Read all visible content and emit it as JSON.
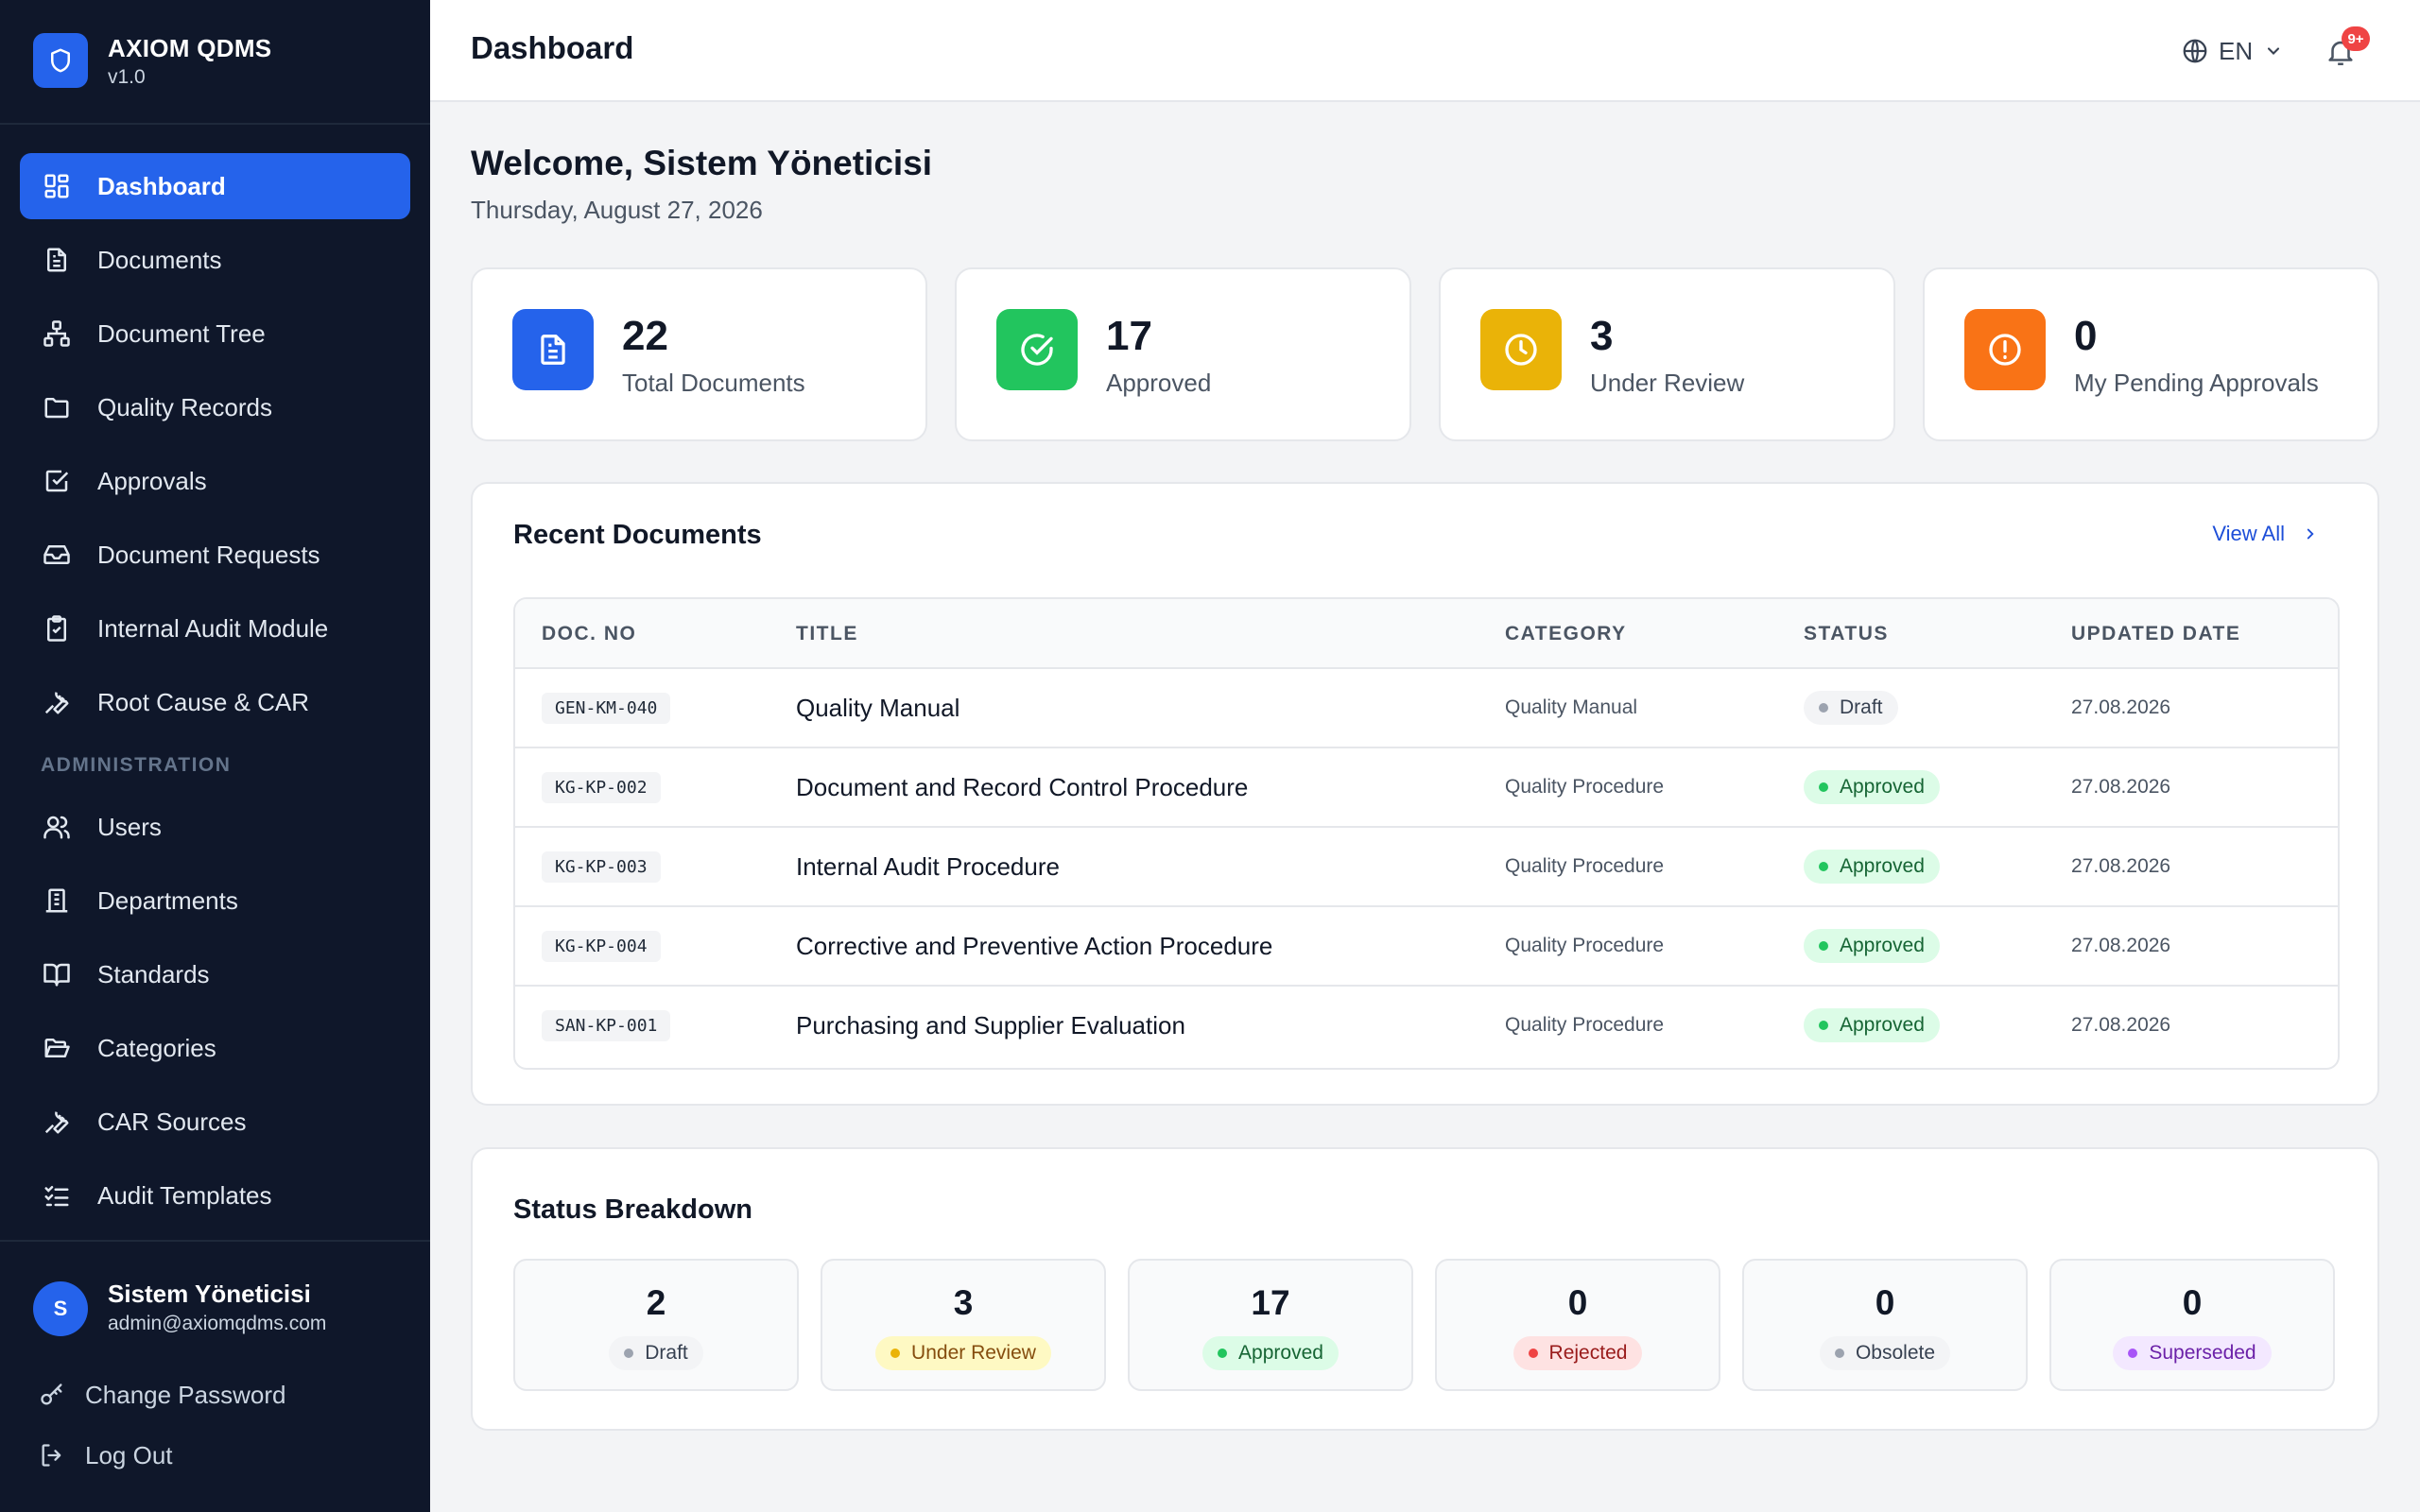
{
  "brand": {
    "name": "AXIOM QDMS",
    "version": "v1.0",
    "logo_icon": "shield-icon",
    "accent": "#2563eb"
  },
  "sidebar": {
    "items": [
      {
        "label": "Dashboard",
        "icon": "grid-icon",
        "active": true
      },
      {
        "label": "Documents",
        "icon": "document-icon"
      },
      {
        "label": "Document Tree",
        "icon": "tree-icon"
      },
      {
        "label": "Quality Records",
        "icon": "folder-icon"
      },
      {
        "label": "Approvals",
        "icon": "check-square-icon"
      },
      {
        "label": "Document Requests",
        "icon": "inbox-icon"
      },
      {
        "label": "Internal Audit Module",
        "icon": "clipboard-check-icon"
      },
      {
        "label": "Root Cause & CAR",
        "icon": "wrench-icon"
      }
    ],
    "admin_section": "ADMINISTRATION",
    "admin_items": [
      {
        "label": "Users",
        "icon": "users-icon"
      },
      {
        "label": "Departments",
        "icon": "building-icon"
      },
      {
        "label": "Standards",
        "icon": "book-icon"
      },
      {
        "label": "Categories",
        "icon": "folder-open-icon"
      },
      {
        "label": "CAR Sources",
        "icon": "wrench-icon"
      },
      {
        "label": "Audit Templates",
        "icon": "list-check-icon"
      }
    ],
    "user": {
      "initial": "S",
      "name": "Sistem Yöneticisi",
      "email": "admin@axiomqdms.com"
    },
    "change_password": "Change Password",
    "logout": "Log Out"
  },
  "header": {
    "title": "Dashboard",
    "language": "EN",
    "notifications_badge": "9+"
  },
  "welcome": {
    "heading": "Welcome, Sistem Yöneticisi",
    "date": "Thursday, August 27, 2026"
  },
  "stats": [
    {
      "value": "22",
      "label": "Total Documents",
      "color": "#2563eb",
      "icon": "document-icon"
    },
    {
      "value": "17",
      "label": "Approved",
      "color": "#22c55e",
      "icon": "check-circle-icon"
    },
    {
      "value": "3",
      "label": "Under Review",
      "color": "#eab308",
      "icon": "clock-icon"
    },
    {
      "value": "0",
      "label": "My Pending Approvals",
      "color": "#f97316",
      "icon": "alert-circle-icon"
    }
  ],
  "recent": {
    "title": "Recent Documents",
    "view_all": "View All",
    "columns": [
      "DOC. NO",
      "TITLE",
      "CATEGORY",
      "STATUS",
      "UPDATED DATE"
    ],
    "rows": [
      {
        "doc_no": "GEN-KM-040",
        "title": "Quality Manual",
        "category": "Quality Manual",
        "status": "Draft",
        "date": "27.08.2026"
      },
      {
        "doc_no": "KG-KP-002",
        "title": "Document and Record Control Procedure",
        "category": "Quality Procedure",
        "status": "Approved",
        "date": "27.08.2026"
      },
      {
        "doc_no": "KG-KP-003",
        "title": "Internal Audit Procedure",
        "category": "Quality Procedure",
        "status": "Approved",
        "date": "27.08.2026"
      },
      {
        "doc_no": "KG-KP-004",
        "title": "Corrective and Preventive Action Procedure",
        "category": "Quality Procedure",
        "status": "Approved",
        "date": "27.08.2026"
      },
      {
        "doc_no": "SAN-KP-001",
        "title": "Purchasing and Supplier Evaluation",
        "category": "Quality Procedure",
        "status": "Approved",
        "date": "27.08.2026"
      }
    ]
  },
  "breakdown": {
    "title": "Status Breakdown",
    "items": [
      {
        "value": "2",
        "label": "Draft",
        "bg": "#f3f4f6",
        "fg": "#374151",
        "dot": "#9ca3af"
      },
      {
        "value": "3",
        "label": "Under Review",
        "bg": "#fef9c3",
        "fg": "#854d0e",
        "dot": "#eab308"
      },
      {
        "value": "17",
        "label": "Approved",
        "bg": "#dcfce7",
        "fg": "#166534",
        "dot": "#22c55e"
      },
      {
        "value": "0",
        "label": "Rejected",
        "bg": "#fee2e2",
        "fg": "#991b1b",
        "dot": "#ef4444"
      },
      {
        "value": "0",
        "label": "Obsolete",
        "bg": "#f3f4f6",
        "fg": "#374151",
        "dot": "#9ca3af"
      },
      {
        "value": "0",
        "label": "Superseded",
        "bg": "#f3e8ff",
        "fg": "#6b21a8",
        "dot": "#a855f7"
      }
    ]
  }
}
